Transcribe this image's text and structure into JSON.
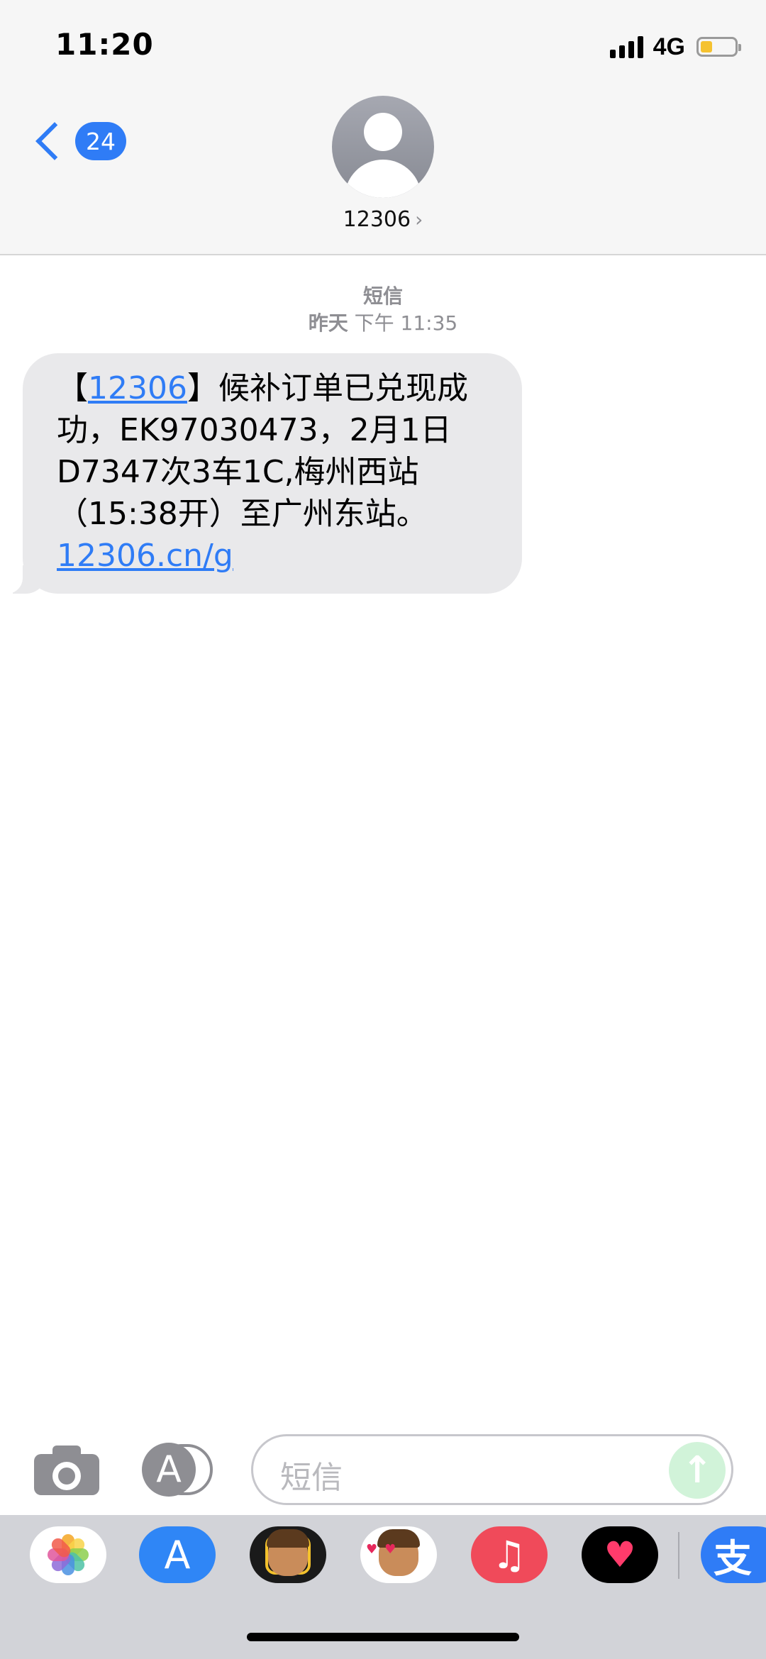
{
  "status_bar": {
    "time": "11:20",
    "network": "4G",
    "battery_level": 0.35,
    "battery_color": "#f5c230"
  },
  "header": {
    "unread_count": "24",
    "contact_name": "12306",
    "contact_chevron": "›",
    "accent_color": "#2f7cf6"
  },
  "thread": {
    "service_label": "短信",
    "timestamp_day": "昨天",
    "timestamp_time": "下午 11:35",
    "message": {
      "open_bracket": "【",
      "sender_link": "12306",
      "line1_rest": "】候补订单已兑现成",
      "line2": "功，EK97030473，2月1日",
      "line3": "D7347次3车1C,梅州西站",
      "line4": "（15:38开）至广州东站。",
      "url": "12306.cn/g"
    }
  },
  "input_bar": {
    "placeholder": "短信",
    "send_symbol": "↑",
    "app_store_symbol": "A"
  },
  "app_drawer": {
    "apps": [
      {
        "name": "photos",
        "icon": "photos-icon"
      },
      {
        "name": "app-store",
        "icon": "app-store-icon",
        "symbol": "A"
      },
      {
        "name": "memoji",
        "icon": "memoji-icon"
      },
      {
        "name": "memoji-stickers",
        "icon": "memoji-stickers-icon"
      },
      {
        "name": "music",
        "icon": "music-icon",
        "symbol": "♫"
      },
      {
        "name": "fitness",
        "icon": "fitness-heart-icon",
        "symbol": "♥"
      },
      {
        "name": "alipay",
        "icon": "alipay-icon",
        "symbol": "支"
      }
    ]
  }
}
